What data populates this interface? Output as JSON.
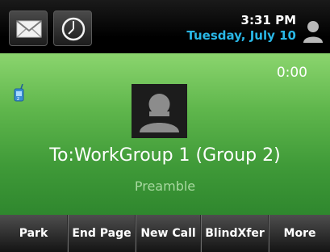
{
  "status_bar": {
    "time": "3:31 PM",
    "date": "Tuesday, July 10",
    "icons": [
      "envelope-icon",
      "clock-icon",
      "user-icon"
    ]
  },
  "call": {
    "timer": "0:00",
    "target": "To:WorkGroup 1 (Group 2)",
    "status": "Preamble",
    "line_icon": "paging-line-icon",
    "avatar_icon": "contact-avatar-icon"
  },
  "softkeys": [
    "Park",
    "End Page",
    "New Call",
    "BlindXfer",
    "More"
  ],
  "colors": {
    "accent_date": "#29b7e6",
    "call_background": "#4fa843",
    "softkey_background": "#2e2e2e"
  }
}
